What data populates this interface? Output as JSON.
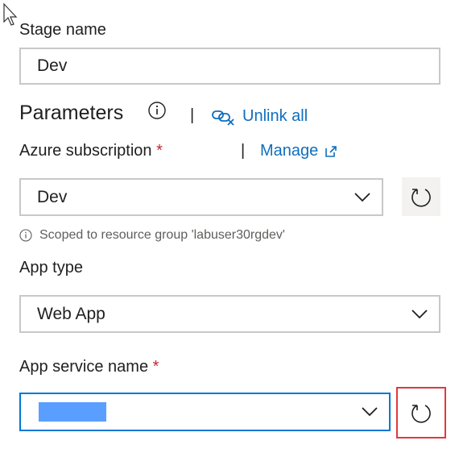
{
  "stage": {
    "label": "Stage name",
    "value": "Dev"
  },
  "parameters": {
    "title": "Parameters",
    "separator": "|",
    "unlink_label": "Unlink all",
    "info_icon": "info-icon",
    "unlink_icon": "unlink-icon"
  },
  "subscription": {
    "label": "Azure subscription",
    "required_mark": "*",
    "separator": "|",
    "manage_label": "Manage",
    "manage_icon": "external-link-icon",
    "selected": "Dev",
    "scope_note": "Scoped to resource group 'labuser30rgdev'"
  },
  "app_type": {
    "label": "App type",
    "selected": "Web App"
  },
  "app_service": {
    "label": "App service name",
    "required_mark": "*",
    "selected": ""
  },
  "colors": {
    "accent": "#0078d4",
    "link": "#106ebe",
    "required": "#c4262e",
    "highlight_box": "#e0393e",
    "selection": "#3d8eff"
  }
}
